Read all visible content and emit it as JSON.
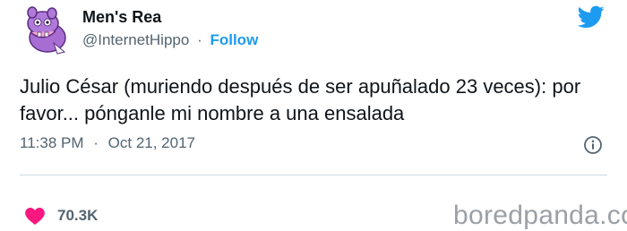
{
  "author": {
    "display_name": "Men's Rea",
    "handle": "@InternetHippo",
    "separator": "·",
    "follow_label": "Follow",
    "avatar_icon": "purple-hippo-avatar-icon"
  },
  "tweet": {
    "text": "Julio César (muriendo después de ser apuñalado 23 veces): por favor... pónganle mi nombre a una ensalada",
    "time": "11:38 PM",
    "meta_separator": "·",
    "date": "Oct 21, 2017"
  },
  "engagement": {
    "likes": "70.3K",
    "like_icon": "heart-icon"
  },
  "watermark": "boredpanda.com",
  "colors": {
    "accent": "#1d9bf0",
    "like": "#f91880",
    "secondary_text": "#536471",
    "avatar": "#9b59c6"
  }
}
